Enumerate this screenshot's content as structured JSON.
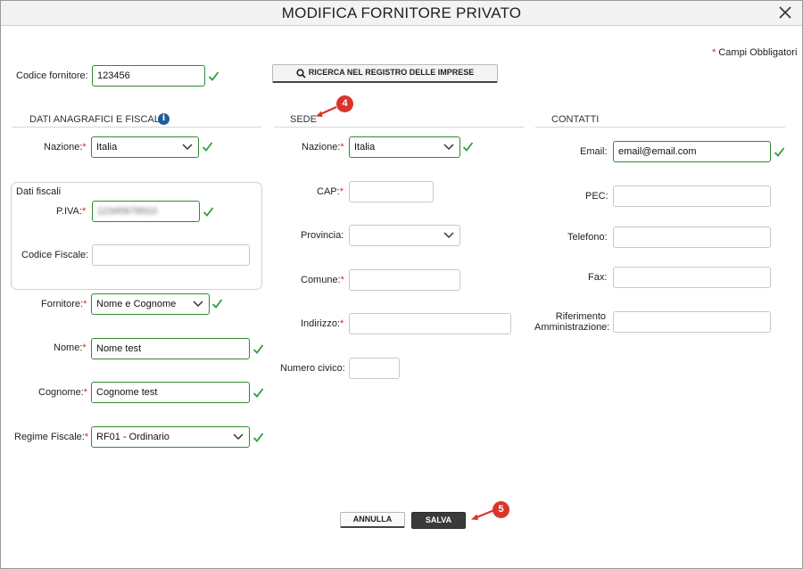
{
  "dialog": {
    "title": "MODIFICA FORNITORE PRIVATO",
    "close_icon": "close-icon",
    "required_marker": "*",
    "required_note": "Campi Obbligatori"
  },
  "top": {
    "supplier_code_label": "Codice fornitore:",
    "supplier_code_value": "123456",
    "search_button_label": "RICERCA NEL REGISTRO DELLE IMPRESE"
  },
  "anagrafica": {
    "heading": "DATI ANAGRAFICI E FISCALI",
    "info_glyph": "i",
    "nazione_label": "Nazione:",
    "nazione_value": "Italia",
    "fiscal_group_title": "Dati fiscali",
    "piva_label": "P.IVA:",
    "piva_value": "12345678910",
    "codice_fiscale_label": "Codice Fiscale:",
    "codice_fiscale_value": "",
    "fornitore_label": "Fornitore:",
    "fornitore_value": "Nome e Cognome",
    "nome_label": "Nome:",
    "nome_value": "Nome test",
    "cognome_label": "Cognome:",
    "cognome_value": "Cognome test",
    "regime_label": "Regime Fiscale:",
    "regime_value": "RF01 - Ordinario"
  },
  "sede": {
    "heading": "SEDE",
    "badge": "4",
    "nazione_label": "Nazione:",
    "nazione_value": "Italia",
    "cap_label": "CAP:",
    "provincia_label": "Provincia:",
    "comune_label": "Comune:",
    "indirizzo_label": "Indirizzo:",
    "numero_civico_label": "Numero civico:"
  },
  "contatti": {
    "heading": "CONTATTI",
    "email_label": "Email:",
    "email_value": "email@email.com",
    "pec_label": "PEC:",
    "telefono_label": "Telefono:",
    "fax_label": "Fax:",
    "riferimento_label_1": "Riferimento",
    "riferimento_label_2": "Amministrazione:"
  },
  "footer": {
    "cancel_label": "ANNULLA",
    "save_label": "SALVA",
    "badge": "5"
  },
  "colors": {
    "valid_border": "#2f8b2f",
    "check": "#2e9e3a",
    "required": "#d6262b",
    "badge": "#d9342b",
    "save_bg": "#3a3a3a"
  }
}
